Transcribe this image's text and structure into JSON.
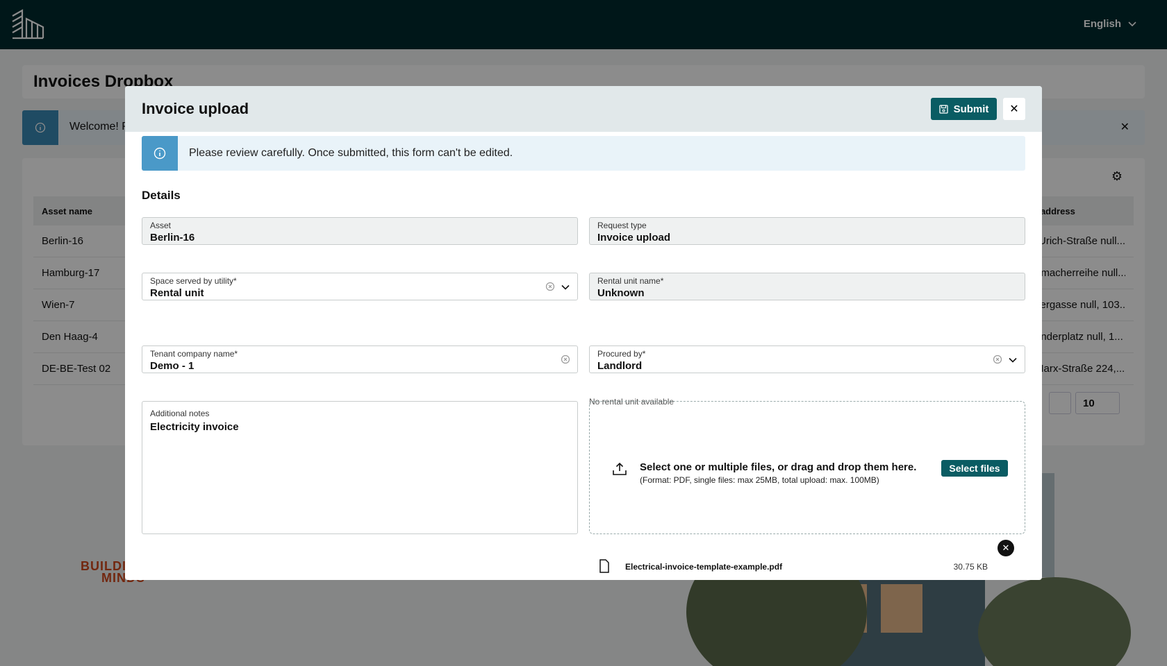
{
  "topbar": {
    "language": "English"
  },
  "background": {
    "page_title": "Invoices Dropbox",
    "welcome_text": "Welcome! P",
    "table": {
      "headers": {
        "asset_name": "Asset name",
        "address": "t address"
      },
      "rows": [
        {
          "asset": "Berlin-16",
          "address": "-Urich-Straße null..."
        },
        {
          "asset": "Hamburg-17",
          "address": "amacherreihe null..."
        },
        {
          "asset": "Wien-7",
          "address": "kergasse null, 103..."
        },
        {
          "asset": "Den Haag-4",
          "address": "anderplatz null, 1..."
        },
        {
          "asset": "DE-BE-Test 02",
          "address": "Marx-Straße 224,..."
        }
      ],
      "page_size": "10"
    },
    "brand_logo_line1": "BUILDI",
    "brand_logo_line2": "MINDS"
  },
  "modal": {
    "title": "Invoice upload",
    "submit_label": "Submit",
    "notice": "Please review carefully. Once submitted, this form can't be edited.",
    "section_title": "Details",
    "fields": {
      "asset": {
        "label": "Asset",
        "value": "Berlin-16"
      },
      "request_type": {
        "label": "Request type",
        "value": "Invoice upload"
      },
      "space_served": {
        "label": "Space served by utility*",
        "value": "Rental unit"
      },
      "rental_unit": {
        "label": "Rental unit name*",
        "value": "Unknown",
        "helper": "No rental unit available"
      },
      "tenant_company": {
        "label": "Tenant company name*",
        "value": "Demo - 1"
      },
      "procured_by": {
        "label": "Procured by*",
        "value": "Landlord"
      },
      "notes": {
        "label": "Additional notes",
        "value": "Electricity invoice"
      }
    },
    "dropzone": {
      "main_text": "Select one or multiple files, or drag and drop them here.",
      "sub_text": "(Format: PDF, single files: max 25MB, total upload: max. 100MB)",
      "button_label": "Select files"
    },
    "files": [
      {
        "name": "Electrical-invoice-template-example.pdf",
        "size": "30.75 KB"
      }
    ]
  },
  "colors": {
    "brand_dark": "#002a2f",
    "primary": "#0a5c63",
    "info": "#4a99c8"
  }
}
